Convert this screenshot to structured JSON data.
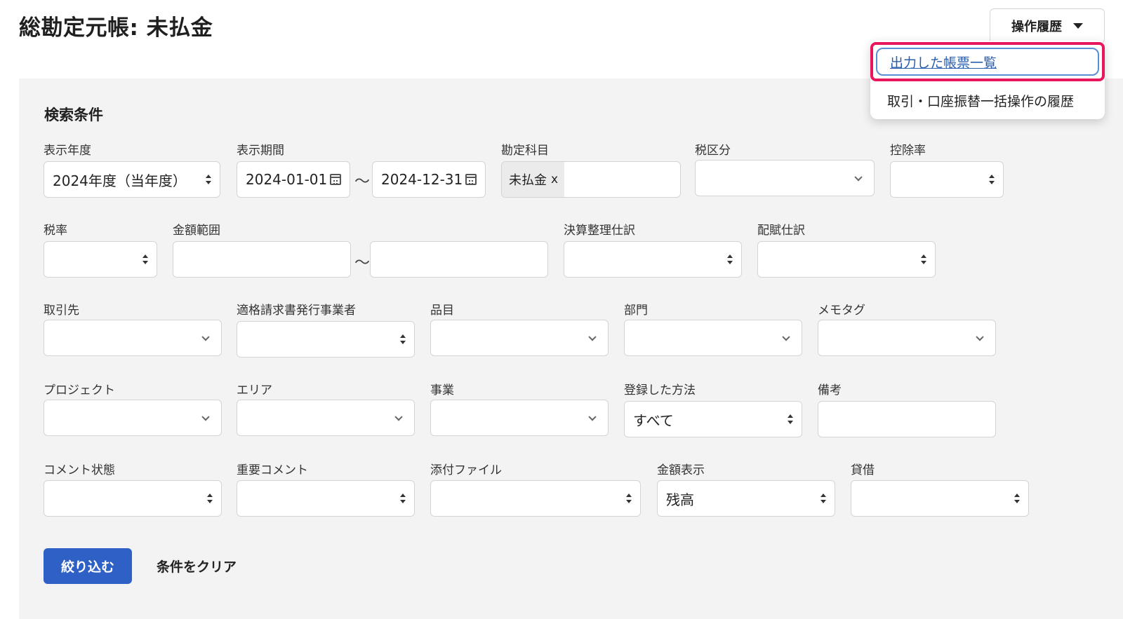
{
  "page": {
    "title": "総勘定元帳: 未払金"
  },
  "history_menu": {
    "button_label": "操作履歴",
    "items": [
      {
        "label": "出力した帳票一覧"
      },
      {
        "label": "取引・口座振替一括操作の履歴"
      }
    ]
  },
  "search": {
    "heading": "検索条件",
    "separator": "〜",
    "fields": {
      "fiscal_year": {
        "label": "表示年度",
        "value": "2024年度（当年度）"
      },
      "period": {
        "label": "表示期間",
        "start": "2024-01-01",
        "end": "2024-12-31"
      },
      "account": {
        "label": "勘定科目",
        "tag": "未払金",
        "tag_remove": "x"
      },
      "tax_category": {
        "label": "税区分",
        "value": ""
      },
      "deduction_rate": {
        "label": "控除率",
        "value": ""
      },
      "tax_rate": {
        "label": "税率",
        "value": ""
      },
      "amount_range": {
        "label": "金額範囲",
        "min": "",
        "max": ""
      },
      "closing_entry": {
        "label": "決算整理仕訳",
        "value": ""
      },
      "allocation_entry": {
        "label": "配賦仕訳",
        "value": ""
      },
      "partner": {
        "label": "取引先",
        "value": ""
      },
      "invoice_issuer": {
        "label": "適格請求書発行事業者",
        "value": ""
      },
      "item": {
        "label": "品目",
        "value": ""
      },
      "department": {
        "label": "部門",
        "value": ""
      },
      "memo_tag": {
        "label": "メモタグ",
        "value": ""
      },
      "project": {
        "label": "プロジェクト",
        "value": ""
      },
      "area": {
        "label": "エリア",
        "value": ""
      },
      "business": {
        "label": "事業",
        "value": ""
      },
      "registration_method": {
        "label": "登録した方法",
        "value": "すべて"
      },
      "remarks": {
        "label": "備考",
        "value": ""
      },
      "comment_status": {
        "label": "コメント状態",
        "value": ""
      },
      "important_comment": {
        "label": "重要コメント",
        "value": ""
      },
      "attachment": {
        "label": "添付ファイル",
        "value": ""
      },
      "amount_display": {
        "label": "金額表示",
        "value": "残高"
      },
      "debit_credit": {
        "label": "貸借",
        "value": ""
      }
    },
    "filter_button": "絞り込む",
    "clear_button": "条件をクリア"
  }
}
